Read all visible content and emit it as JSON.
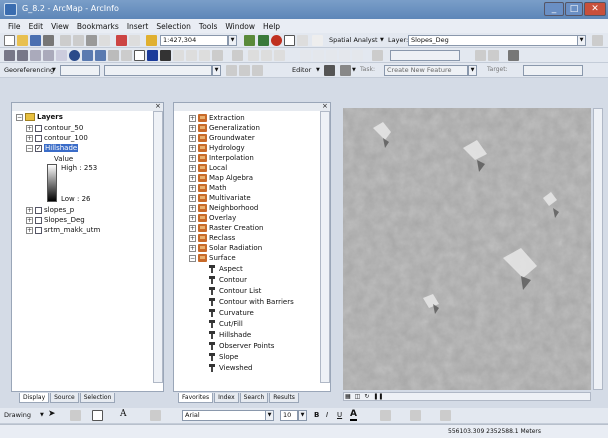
{
  "window": {
    "title": "G_8.2 - ArcMap - ArcInfo"
  },
  "menu": [
    "File",
    "Edit",
    "View",
    "Bookmarks",
    "Insert",
    "Selection",
    "Tools",
    "Window",
    "Help"
  ],
  "toolbar": {
    "scale": "1:427,304",
    "spatial_analyst": "Spatial Analyst",
    "layer_label": "Layer:",
    "layer_value": "Slopes_Deg",
    "georeferencing": "Georeferencing",
    "editor": "Editor",
    "create_feature": "Create New Feature"
  },
  "toc": {
    "layers_label": "Layers",
    "items": [
      {
        "label": "contour_50",
        "checked": false
      },
      {
        "label": "contour_100",
        "checked": false
      },
      {
        "label": "Hillshade",
        "checked": true
      }
    ],
    "legend_value": "Value",
    "legend_high": "High : 253",
    "legend_low": "Low : 26",
    "items2": [
      {
        "label": "slopes_p",
        "checked": false
      },
      {
        "label": "Slopes_Deg",
        "checked": false
      },
      {
        "label": "srtm_makk_utm",
        "checked": false
      }
    ],
    "tabs": [
      "Display",
      "Source",
      "Selection"
    ]
  },
  "arctoolbox": {
    "toolsets": [
      "Extraction",
      "Generalization",
      "Groundwater",
      "Hydrology",
      "Interpolation",
      "Local",
      "Map Algebra",
      "Math",
      "Multivariate",
      "Neighborhood",
      "Overlay",
      "Raster Creation",
      "Reclass",
      "Solar Radiation",
      "Surface"
    ],
    "tools": [
      "Aspect",
      "Contour",
      "Contour List",
      "Contour with Barriers",
      "Curvature",
      "Cut/Fill",
      "Hillshade",
      "Observer Points",
      "Slope",
      "Viewshed"
    ],
    "tabs": [
      "Favorites",
      "Index",
      "Search",
      "Results"
    ]
  },
  "draw_toolbar": {
    "drawing": "Drawing",
    "font": "Arial",
    "size": "10",
    "bold": "B",
    "italic": "I",
    "underline": "U",
    "font_color_label": "A"
  },
  "status": {
    "coordinates": "556103.309  2352588.1 Meters"
  },
  "colors": {
    "titlebar": "#5d86b8",
    "hillshade_base": "#a6a6a6"
  }
}
